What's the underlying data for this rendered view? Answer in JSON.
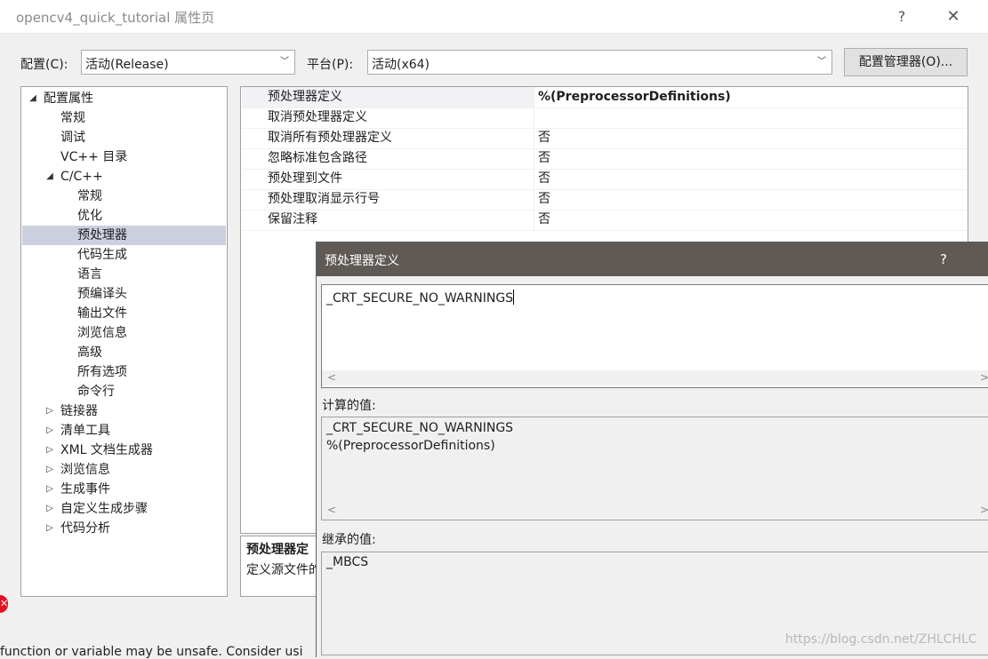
{
  "window": {
    "title": "opencv4_quick_tutorial 属性页",
    "help": "?",
    "close": "✕"
  },
  "config": {
    "config_label": "配置(C):",
    "config_value": "活动(Release)",
    "platform_label": "平台(P):",
    "platform_value": "活动(x64)",
    "manager_button": "配置管理器(O)..."
  },
  "tree": {
    "items": [
      {
        "label": "配置属性",
        "level": 0,
        "expander": "◢",
        "selected": false
      },
      {
        "label": "常规",
        "level": 1,
        "expander": "",
        "selected": false
      },
      {
        "label": "调试",
        "level": 1,
        "expander": "",
        "selected": false
      },
      {
        "label": "VC++ 目录",
        "level": 1,
        "expander": "",
        "selected": false
      },
      {
        "label": "C/C++",
        "level": 1,
        "expander": "◢",
        "selected": false
      },
      {
        "label": "常规",
        "level": 2,
        "expander": "",
        "selected": false
      },
      {
        "label": "优化",
        "level": 2,
        "expander": "",
        "selected": false
      },
      {
        "label": "预处理器",
        "level": 2,
        "expander": "",
        "selected": true
      },
      {
        "label": "代码生成",
        "level": 2,
        "expander": "",
        "selected": false
      },
      {
        "label": "语言",
        "level": 2,
        "expander": "",
        "selected": false
      },
      {
        "label": "预编译头",
        "level": 2,
        "expander": "",
        "selected": false
      },
      {
        "label": "输出文件",
        "level": 2,
        "expander": "",
        "selected": false
      },
      {
        "label": "浏览信息",
        "level": 2,
        "expander": "",
        "selected": false
      },
      {
        "label": "高级",
        "level": 2,
        "expander": "",
        "selected": false
      },
      {
        "label": "所有选项",
        "level": 2,
        "expander": "",
        "selected": false
      },
      {
        "label": "命令行",
        "level": 2,
        "expander": "",
        "selected": false
      },
      {
        "label": "链接器",
        "level": 1,
        "expander": "▷",
        "selected": false
      },
      {
        "label": "清单工具",
        "level": 1,
        "expander": "▷",
        "selected": false
      },
      {
        "label": "XML 文档生成器",
        "level": 1,
        "expander": "▷",
        "selected": false
      },
      {
        "label": "浏览信息",
        "level": 1,
        "expander": "▷",
        "selected": false
      },
      {
        "label": "生成事件",
        "level": 1,
        "expander": "▷",
        "selected": false
      },
      {
        "label": "自定义生成步骤",
        "level": 1,
        "expander": "▷",
        "selected": false
      },
      {
        "label": "代码分析",
        "level": 1,
        "expander": "▷",
        "selected": false
      }
    ]
  },
  "grid": {
    "rows": [
      {
        "name": "预处理器定义",
        "value": "%(PreprocessorDefinitions)",
        "selected": true
      },
      {
        "name": "取消预处理器定义",
        "value": "",
        "selected": false
      },
      {
        "name": "取消所有预处理器定义",
        "value": "否",
        "selected": false
      },
      {
        "name": "忽略标准包含路径",
        "value": "否",
        "selected": false
      },
      {
        "name": "预处理到文件",
        "value": "否",
        "selected": false
      },
      {
        "name": "预处理取消显示行号",
        "value": "否",
        "selected": false
      },
      {
        "name": "保留注释",
        "value": "否",
        "selected": false
      }
    ]
  },
  "description": {
    "title": "预处理器定",
    "text": "定义源文件的"
  },
  "dialog": {
    "title": "预处理器定义",
    "help": "?",
    "edit_value": "_CRT_SECURE_NO_WARNINGS",
    "calc_label": "计算的值:",
    "calc_lines": [
      "_CRT_SECURE_NO_WARNINGS",
      "%(PreprocessorDefinitions)"
    ],
    "inherited_label": "继承的值:",
    "inherited_lines": [
      "_MBCS"
    ],
    "scroll_left": "<",
    "scroll_right": ">"
  },
  "background": {
    "status_text": "function or variable may be unsafe. Consider usi"
  },
  "watermark": "https://blog.csdn.net/ZHLCHLC",
  "colors": {
    "dialog_titlebar": "#5f5a55",
    "tree_selection": "#ccd0de",
    "error_red": "#e81123"
  },
  "icons": {
    "expanded": "triangle-down-right",
    "collapsed": "triangle-right",
    "dropdown": "chevron-down"
  }
}
